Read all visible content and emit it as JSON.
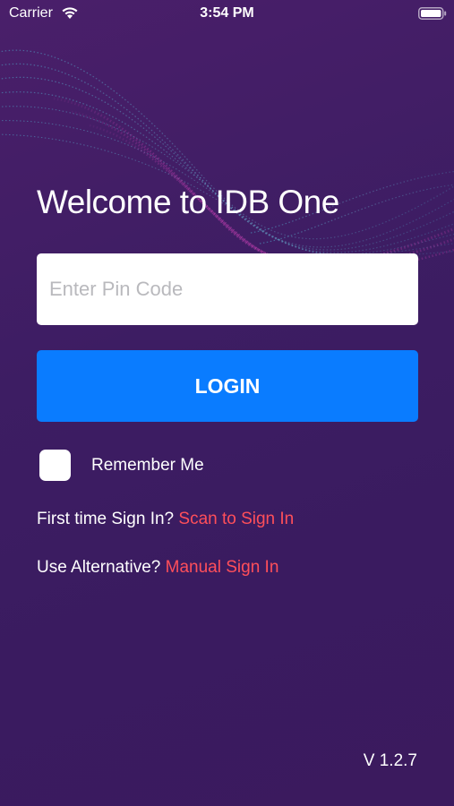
{
  "status_bar": {
    "carrier": "Carrier",
    "time": "3:54 PM",
    "wifi_icon": "wifi-icon",
    "battery_icon": "battery-icon"
  },
  "login": {
    "title": "Welcome to IDB One",
    "pin_placeholder": "Enter Pin Code",
    "pin_value": "",
    "login_button": "LOGIN",
    "remember_label": "Remember Me",
    "remember_checked": false,
    "first_time_prompt": "First time Sign In?",
    "scan_link": "Scan to Sign In",
    "alternative_prompt": "Use Alternative?",
    "manual_link": "Manual Sign In"
  },
  "footer": {
    "version": "V 1.2.7"
  },
  "colors": {
    "background": "#3d1d63",
    "button": "#0a7cff",
    "link": "#ff4f5a"
  }
}
